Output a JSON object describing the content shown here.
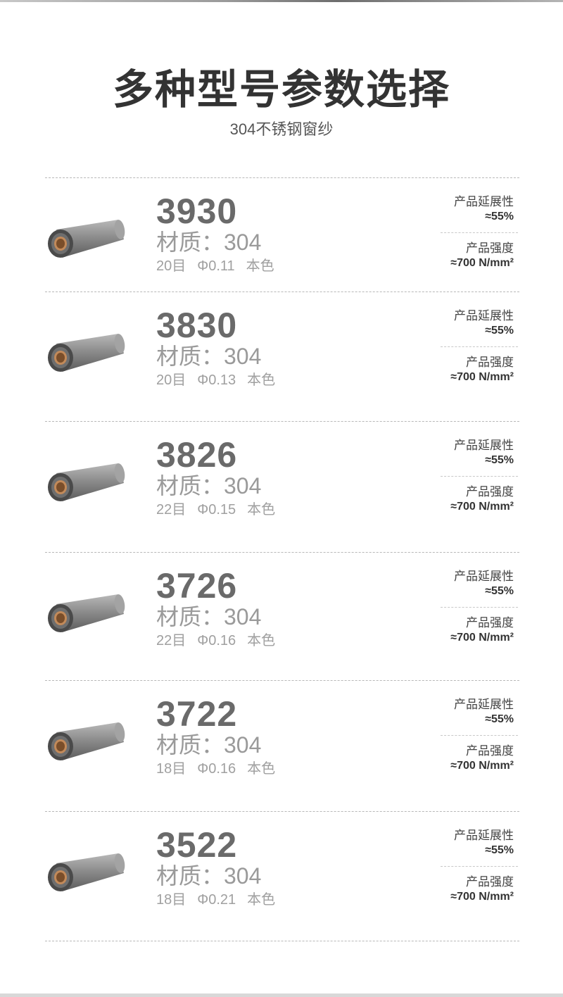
{
  "header": {
    "title": "多种型号参数选择",
    "subtitle": "304不锈钢窗纱"
  },
  "products": [
    {
      "model": "3930",
      "material": "材质：304",
      "mesh": "20目",
      "diameter": "Φ0.11",
      "color": "本色",
      "elongation_label": "产品延展性",
      "elongation_value": "≈55%",
      "strength_label": "产品强度",
      "strength_value": "≈700 N/mm²"
    },
    {
      "model": "3830",
      "material": "材质：304",
      "mesh": "20目",
      "diameter": "Φ0.13",
      "color": "本色",
      "elongation_label": "产品延展性",
      "elongation_value": "≈55%",
      "strength_label": "产品强度",
      "strength_value": "≈700 N/mm²"
    },
    {
      "model": "3826",
      "material": "材质：304",
      "mesh": "22目",
      "diameter": "Φ0.15",
      "color": "本色",
      "elongation_label": "产品延展性",
      "elongation_value": "≈55%",
      "strength_label": "产品强度",
      "strength_value": "≈700 N/mm²"
    },
    {
      "model": "3726",
      "material": "材质：304",
      "mesh": "22目",
      "diameter": "Φ0.16",
      "color": "本色",
      "elongation_label": "产品延展性",
      "elongation_value": "≈55%",
      "strength_label": "产品强度",
      "strength_value": "≈700 N/mm²"
    },
    {
      "model": "3722",
      "material": "材质：304",
      "mesh": "18目",
      "diameter": "Φ0.16",
      "color": "本色",
      "elongation_label": "产品延展性",
      "elongation_value": "≈55%",
      "strength_label": "产品强度",
      "strength_value": "≈700 N/mm²"
    },
    {
      "model": "3522",
      "material": "材质：304",
      "mesh": "18目",
      "diameter": "Φ0.21",
      "color": "本色",
      "elongation_label": "产品延展性",
      "elongation_value": "≈55%",
      "strength_label": "产品强度",
      "strength_value": "≈700 N/mm²"
    }
  ]
}
